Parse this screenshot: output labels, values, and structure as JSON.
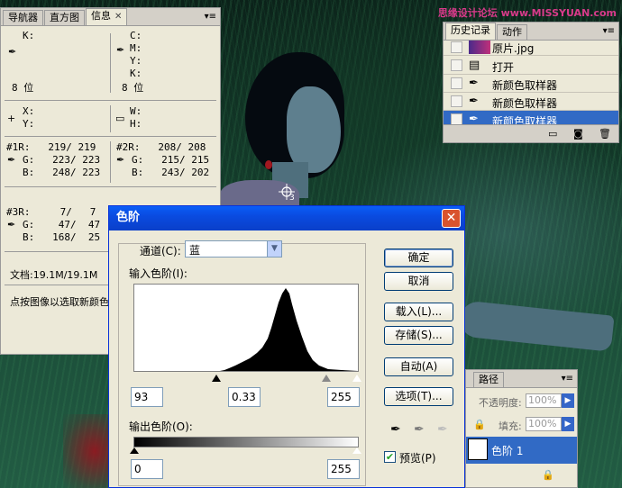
{
  "watermark": "思缘设计论坛 www.MISSYUAN.com",
  "info_palette": {
    "tabs": [
      {
        "label": "导航器",
        "active": false
      },
      {
        "label": "直方图",
        "active": false
      },
      {
        "label": "信息",
        "active": true
      }
    ],
    "k_label": "K:",
    "bitdepth_left": "8 位",
    "c_label": "C:",
    "m_label": "M:",
    "y_label": "Y:",
    "k2_label": "K:",
    "bitdepth_right": "8 位",
    "x_label": "X:",
    "y_pos_label": "Y:",
    "w_label": "W:",
    "h_label": "H:",
    "sampler1": {
      "r": "#1R:   219/ 219",
      "g": "G:   223/ 223",
      "b": "B:   248/ 223"
    },
    "sampler2": {
      "r": "#2R:   208/ 208",
      "g": "G:   215/ 215",
      "b": "B:   243/ 202"
    },
    "sampler3": {
      "r": "#3R:     7/   7",
      "g": "G:    47/  47",
      "b": "B:   168/  25"
    },
    "doc_size": "文档:19.1M/19.1M",
    "hint": "点按图像以选取新颜色"
  },
  "history_palette": {
    "tabs": [
      {
        "label": "历史记录",
        "active": true
      },
      {
        "label": "动作",
        "active": false
      }
    ],
    "snapshot_label": "原片.jpg",
    "items": [
      {
        "label": "打开",
        "selected": false
      },
      {
        "label": "新颜色取样器",
        "selected": false
      },
      {
        "label": "新颜色取样器",
        "selected": false
      },
      {
        "label": "新颜色取样器",
        "selected": true
      }
    ]
  },
  "layers_palette": {
    "tab_label": "路径",
    "opacity_label": "不透明度:",
    "opacity_value": "100%",
    "fill_label": "填充:",
    "fill_value": "100%",
    "layer_name": "色阶 1"
  },
  "levels_dialog": {
    "title": "色阶",
    "channel_label": "通道(C):",
    "channel_value": "蓝",
    "input_label": "输入色阶(I):",
    "input_black": "93",
    "input_gamma": "0.33",
    "input_white": "255",
    "output_label": "输出色阶(O):",
    "output_black": "0",
    "output_white": "255",
    "buttons": {
      "ok": "确定",
      "cancel": "取消",
      "load": "载入(L)...",
      "save": "存储(S)...",
      "auto": "自动(A)",
      "options": "选项(T)..."
    },
    "preview_label": "预览(P)",
    "preview_checked": true
  },
  "sampler_marker": "3",
  "colors": {
    "titlebar": "#0a4be0",
    "selection": "#316ac5",
    "panel": "#ece9d8"
  }
}
